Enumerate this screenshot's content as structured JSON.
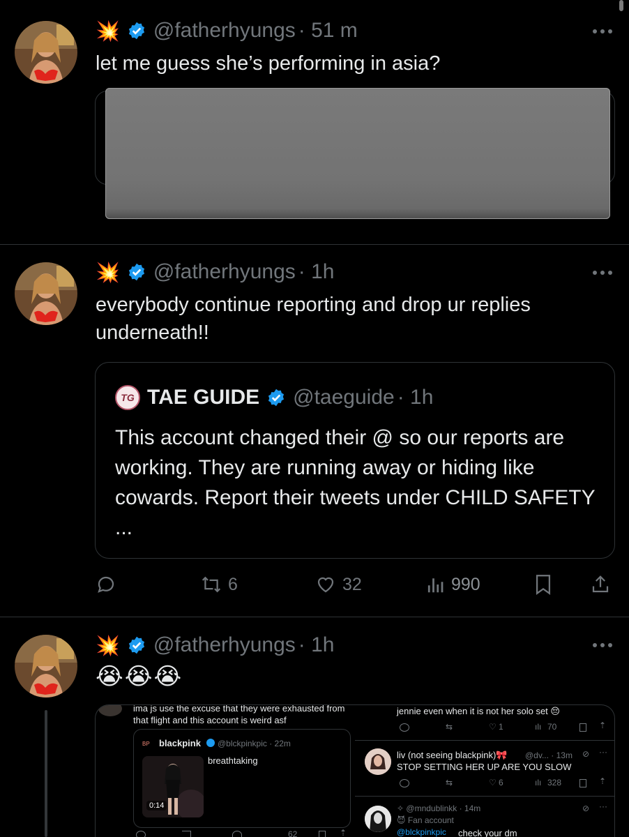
{
  "colors": {
    "background": "#000000",
    "text": "#e7e9ea",
    "muted": "#71767b",
    "divider": "#2f3336",
    "verified": "#1d9bf0",
    "redaction": "#767676"
  },
  "tweets": [
    {
      "emoji": "💥",
      "handle": "@fatherhyungs",
      "time": "· 51 m",
      "text": "let me guess she’s performing in asia?"
    },
    {
      "emoji": "💥",
      "handle": "@fatherhyungs",
      "time": "· 1h",
      "text": "everybody continue reporting and drop ur replies underneath!!",
      "quote": {
        "logo": "TG",
        "name": "TAE GUIDE",
        "handle": "@taeguide",
        "time": "· 1h",
        "text": "This account changed their @ so our reports are working. They are running away or hiding like cowards. Report their tweets  under CHILD SAFETY ..."
      },
      "actions": {
        "retweets": "6",
        "likes": "32",
        "views": "990"
      }
    },
    {
      "emoji": "💥",
      "handle": "@fatherhyungs",
      "time": "· 1h",
      "text": "😭😭😭"
    }
  ],
  "media": {
    "left_text": "ima js use the excuse that they were exhausted from that flight and this account is weird asf",
    "inner_name": "blackpink",
    "inner_handle": "@blckpinkpic · 22m",
    "inner_text": "breathtaking",
    "video_time": "0:14",
    "left_views": "62",
    "right_top_text": "jennie even when it is not her solo set 😔",
    "right_top_likes": "1",
    "right_top_views": "70",
    "reply1_name": "liv (not seeing blackpink)🎀",
    "reply1_handle": "@dv... · 13m",
    "reply1_text": "STOP SETTING HER UP ARE YOU SLOW",
    "reply1_likes": "6",
    "reply1_views": "328",
    "reply2_handle": "✧ @mndublinkk · 14m",
    "reply2_label": "😈 Fan account",
    "reply2_mention": "@blckpinkpic",
    "reply2_text": "check your dm"
  }
}
